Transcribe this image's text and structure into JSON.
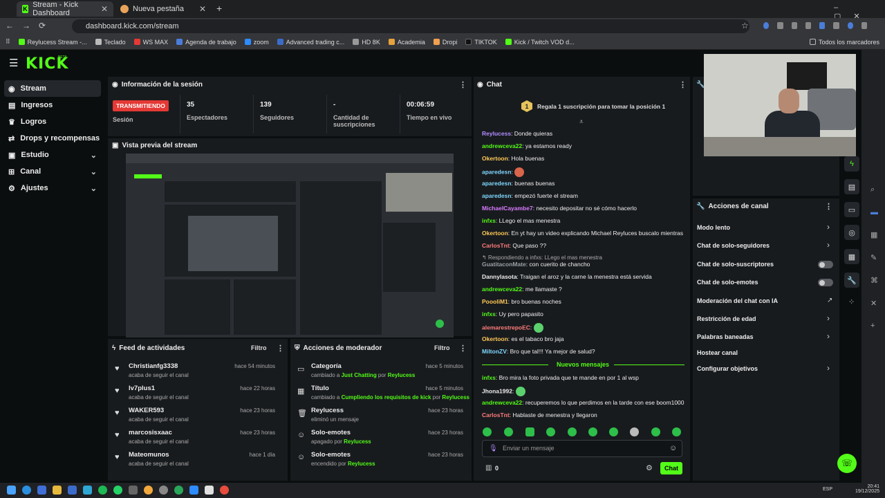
{
  "browser": {
    "tabs": [
      {
        "title": "Stream - Kick Dashboard"
      },
      {
        "title": "Nueva pestaña"
      }
    ],
    "url": "dashboard.kick.com/stream",
    "bookmarks": [
      "Reylucess Stream -...",
      "Teclado",
      "WS MAX",
      "Agenda de trabajo",
      "zoom",
      "Advanced trading c...",
      "HD 8K",
      "Academia",
      "Dropi",
      "TIKTOK",
      "Kick / Twitch VOD d..."
    ],
    "bookmarks_right": "Todos los marcadores"
  },
  "brand": {
    "logo": "KICK",
    "badge": "BETA"
  },
  "sidebar": {
    "items": [
      {
        "label": "Stream",
        "icon": "stream-icon"
      },
      {
        "label": "Ingresos",
        "icon": "revenue-icon"
      },
      {
        "label": "Logros",
        "icon": "trophy-icon"
      },
      {
        "label": "Drops y recompensas",
        "icon": "gift-icon"
      },
      {
        "label": "Estudio",
        "icon": "studio-icon"
      },
      {
        "label": "Canal",
        "icon": "channel-icon"
      },
      {
        "label": "Ajustes",
        "icon": "gear-icon"
      }
    ]
  },
  "session": {
    "title": "Información de la sesión",
    "status": "TRANSMITIENDO",
    "status_label": "Sesión",
    "viewers": "35",
    "viewers_label": "Espectadores",
    "followers": "139",
    "followers_label": "Seguidores",
    "subs": "-",
    "subs_label": "Cantidad de suscripciones",
    "time": "00:06:59",
    "time_label": "Tiempo en vivo"
  },
  "preview": {
    "title": "Vista previa del stream"
  },
  "activity": {
    "title": "Feed de actividades",
    "filter": "Filtro",
    "items": [
      {
        "name": "Christianfg3338",
        "sub": "acaba de seguir el canal",
        "time": "hace 54 minutos"
      },
      {
        "name": "lv7plus1",
        "sub": "acaba de seguir el canal",
        "time": "hace 22 horas"
      },
      {
        "name": "WAKER593",
        "sub": "acaba de seguir el canal",
        "time": "hace 23 horas"
      },
      {
        "name": "marcosisxaac",
        "sub": "acaba de seguir el canal",
        "time": "hace 23 horas"
      },
      {
        "name": "Mateomunos",
        "sub": "acaba de seguir el canal",
        "time": "hace 1 día"
      }
    ]
  },
  "moderator": {
    "title": "Acciones de moderador",
    "filter": "Filtro",
    "items": [
      {
        "name": "Categoría",
        "pre": "cambiado a ",
        "hl": "Just Chatting",
        "mid": " por ",
        "user": "Reylucess",
        "time": "hace 5 minutos",
        "icon": "category-icon"
      },
      {
        "name": "Título",
        "pre": "cambiado a ",
        "hl": "Cumpliendo los requisitos de kick",
        "mid": " por ",
        "user": "Reylucess",
        "time": "hace 5 minutos",
        "icon": "title-icon"
      },
      {
        "name": "Reylucess",
        "pre": "eliminó un mensaje",
        "hl": "",
        "mid": "",
        "user": "",
        "time": "hace 23 horas",
        "icon": "trash-icon"
      },
      {
        "name": "Solo-emotes",
        "pre": "apagado por ",
        "hl": "",
        "mid": "",
        "user": "Reylucess",
        "time": "hace 23 horas",
        "icon": "emote-icon"
      },
      {
        "name": "Solo-emotes",
        "pre": "encendido por ",
        "hl": "",
        "mid": "",
        "user": "Reylucess",
        "time": "hace 23 horas",
        "icon": "emote-icon"
      }
    ]
  },
  "chat": {
    "title": "Chat",
    "gift_banner": "Regala 1 suscripción para tomar la posición 1",
    "gift_rank": "1",
    "messages": [
      {
        "user": "Reylucess",
        "color": "#b18cff",
        "text": "Donde quieras"
      },
      {
        "user": "andrewceva22",
        "color": "#53fc18",
        "text": "ya estamos ready"
      },
      {
        "user": "Okertoon",
        "color": "#ffc857",
        "text": "Hola buenas"
      },
      {
        "user": "aparedesn",
        "color": "#7fd7ff",
        "text": ""
      },
      {
        "user": "aparedesn",
        "color": "#7fd7ff",
        "text": "buenas buenas"
      },
      {
        "user": "aparedesn",
        "color": "#7fd7ff",
        "text": "empezó fuerte el stream"
      },
      {
        "user": "MichaelCayambe7",
        "color": "#d97bff",
        "text": "necesito depositar no sé cómo hacerlo"
      },
      {
        "user": "infxs",
        "color": "#53fc18",
        "text": "LLego el mas menestra"
      },
      {
        "user": "Okertoon",
        "color": "#ffc857",
        "text": "En yt hay un video explicando Michael Reyluces buscalo mientras"
      },
      {
        "user": "CarlosTnt",
        "color": "#ff7b7b",
        "text": "Que paso ??"
      }
    ],
    "reply_note": "Respondiendo a infxs: LLego el mas menestra",
    "messages2": [
      {
        "user": "GuatitaconMate",
        "color": "#9aa0a6",
        "text": "con cuerito de chancho"
      },
      {
        "user": "Dannylasota",
        "color": "#eeeeee",
        "text": "Traigan el aroz y la carne la menestra está servida"
      },
      {
        "user": "andrewceva22",
        "color": "#53fc18",
        "text": "me llamaste ?"
      },
      {
        "user": "PoooliM1",
        "color": "#ffc857",
        "text": "bro buenas noches"
      },
      {
        "user": "infxs",
        "color": "#53fc18",
        "text": "Uy pero papasito"
      },
      {
        "user": "alemarestrepoEC",
        "color": "#ff7b7b",
        "text": ""
      },
      {
        "user": "Okertoon",
        "color": "#ffc857",
        "text": "es el tabaco bro jaja"
      },
      {
        "user": "MiltonZV",
        "color": "#7fd7ff",
        "text": "Bro que tal!!! Ya mejor de salud?"
      }
    ],
    "new_messages": "Nuevos mensajes",
    "messages3": [
      {
        "user": "infxs",
        "color": "#53fc18",
        "text": "Bro mira la foto privada que te mande en por 1 al wsp"
      },
      {
        "user": "Jhona1992",
        "color": "#eeeeee",
        "text": ""
      },
      {
        "user": "andrewceva22",
        "color": "#53fc18",
        "text": "recuperemos lo que perdimos en la tarde con ese boom1000"
      },
      {
        "user": "CarlosTnt",
        "color": "#ff7b7b",
        "text": "Hablaste de menestra y llegaron"
      }
    ],
    "input_placeholder": "Enviar un mensaje",
    "points": "0",
    "send": "Chat"
  },
  "channel_actions": {
    "title": "Acciones de canal",
    "items": [
      {
        "label": "Modo lento",
        "control": "chevron"
      },
      {
        "label": "Chat de solo-seguidores",
        "control": "chevron"
      },
      {
        "label": "Chat de solo-suscriptores",
        "control": "toggle"
      },
      {
        "label": "Chat de solo-emotes",
        "control": "toggle"
      },
      {
        "label": "Moderación del chat con IA",
        "control": "external"
      },
      {
        "label": "Restricción de edad",
        "control": "chevron"
      },
      {
        "label": "Palabras baneadas",
        "control": "chevron"
      },
      {
        "label": "Hostear canal",
        "control": "none"
      },
      {
        "label": "Configurar objetivos",
        "control": "chevron"
      }
    ]
  },
  "taskbar": {
    "lang": "ESP",
    "time": "20:41",
    "date": "19/12/2025"
  },
  "colors": {
    "accent": "#53fc18",
    "live": "#e53935",
    "panel": "#181b1e",
    "bg": "#0b0e0f"
  }
}
